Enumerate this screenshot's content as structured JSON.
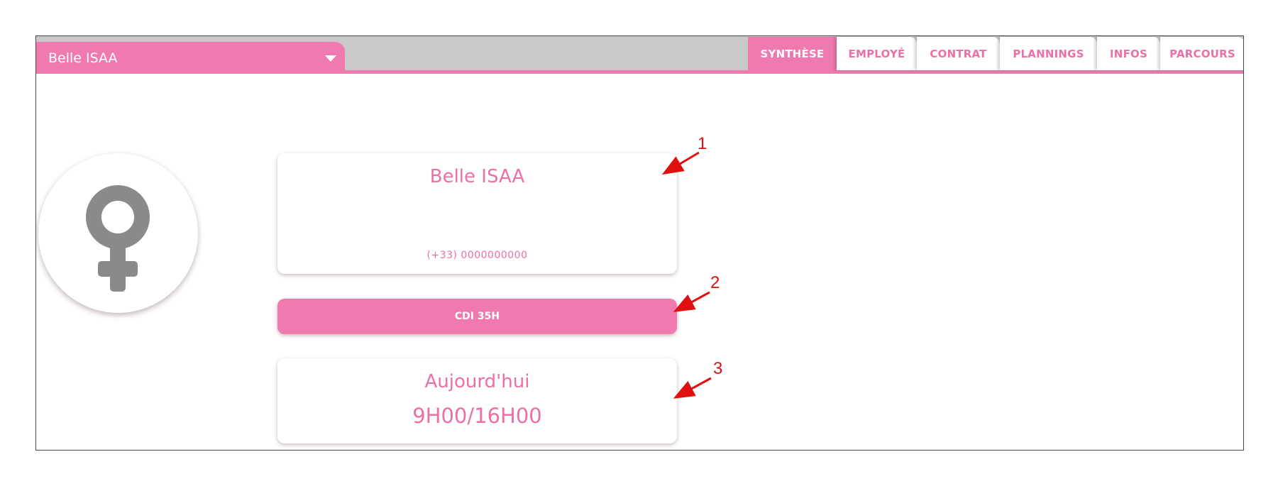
{
  "header": {
    "employee_select_value": "Belle ISAA",
    "tabs": [
      {
        "label": "SYNTHÈSE",
        "active": true
      },
      {
        "label": "EMPLOYÉ",
        "active": false
      },
      {
        "label": "CONTRAT",
        "active": false
      },
      {
        "label": "PLANNINGS",
        "active": false
      },
      {
        "label": "INFOS",
        "active": false
      },
      {
        "label": "PARCOURS",
        "active": false
      }
    ]
  },
  "profile": {
    "avatar_icon": "female-symbol-icon",
    "name": "Belle ISAA",
    "phone": "(+33) 0000000000"
  },
  "contract": {
    "label": "CDI 35H"
  },
  "schedule": {
    "label": "Aujourd'hui",
    "hours": "9H00/16H00"
  },
  "annotations": [
    "1",
    "2",
    "3"
  ],
  "colors": {
    "accent": "#f07ab0",
    "accent_text": "#ec6fa8",
    "tab_bar_bg": "#c9c9c9",
    "icon_gray": "#8a8a8a",
    "annotation_red": "#e01010"
  }
}
